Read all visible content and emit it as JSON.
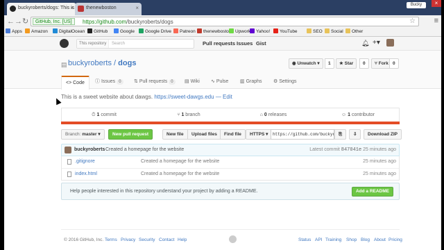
{
  "browser": {
    "tabs": [
      {
        "title": "buckyroberts/dogs: This is"
      },
      {
        "title": "thenewboston"
      }
    ],
    "profile_name": "Bucky",
    "address": {
      "secure_label": "GitHub, Inc. [US]",
      "url_host": "https://github.com",
      "url_path": "/buckyroberts/dogs"
    },
    "bookmarks": [
      {
        "label": "Apps",
        "color": "#4a7bd6"
      },
      {
        "label": "Amazon",
        "color": "#f39a1f"
      },
      {
        "label": "DigitalOcean",
        "color": "#1f8ad6"
      },
      {
        "label": "GitHub",
        "color": "#222222"
      },
      {
        "label": "Google",
        "color": "#4285f4"
      },
      {
        "label": "Google Drive",
        "color": "#1fa463"
      },
      {
        "label": "Patreon",
        "color": "#f96854"
      },
      {
        "label": "thenewboston",
        "color": "#c0392b"
      },
      {
        "label": "Upwork",
        "color": "#6fda44"
      },
      {
        "label": "Yahoo!",
        "color": "#6001d2"
      },
      {
        "label": "YouTube",
        "color": "#e62117"
      },
      {
        "label": "SEO",
        "color": "#e8c35a"
      },
      {
        "label": "Social",
        "color": "#e8c35a"
      },
      {
        "label": "Other",
        "color": "#e8c35a"
      }
    ]
  },
  "github": {
    "search_scope": "This repository",
    "search_placeholder": "Search",
    "nav": [
      "Pull requests",
      "Issues",
      "Gist"
    ]
  },
  "repo": {
    "owner": "buckyroberts",
    "separator": "/",
    "name": "dogs",
    "watch": {
      "label": "Unwatch ▾",
      "count": "1"
    },
    "star": {
      "label": "Star",
      "count": "0"
    },
    "fork": {
      "label": "Fork",
      "count": "0"
    },
    "tabs": [
      {
        "label": "Code",
        "count": ""
      },
      {
        "label": "Issues",
        "count": "0"
      },
      {
        "label": "Pull requests",
        "count": "0"
      },
      {
        "label": "Wiki",
        "count": ""
      },
      {
        "label": "Pulse",
        "count": ""
      },
      {
        "label": "Graphs",
        "count": ""
      },
      {
        "label": "Settings",
        "count": ""
      }
    ],
    "description": "This is a sweet website about dawgs.",
    "website": "https://sweet-dawgs.edu",
    "edit_label": "— Edit",
    "summary": {
      "commits": {
        "num": "1",
        "label": "commit"
      },
      "branches": {
        "num": "1",
        "label": "branch"
      },
      "releases": {
        "num": "0",
        "label": "releases"
      },
      "contributors": {
        "num": "1",
        "label": "contributor"
      }
    },
    "lang_color": "#e34c26",
    "branch_label": "Branch:",
    "branch_value": "master ▾",
    "new_pr": "New pull request",
    "file_buttons": [
      "New file",
      "Upload files",
      "Find file"
    ],
    "clone_protocol": "HTTPS ▾",
    "clone_url": "https://github.com/buckyroberts/dogs.git",
    "download": "Download ZIP",
    "latest_commit": {
      "author": "buckyroberts",
      "message": "Created a homepage for the website",
      "label": "Latest commit",
      "sha": "847041e",
      "age": "25 minutes ago"
    },
    "files": [
      {
        "name": ".gitignore",
        "message": "Created a homepage for the website",
        "age": "25 minutes ago"
      },
      {
        "name": "index.html",
        "message": "Created a homepage for the website",
        "age": "25 minutes ago"
      }
    ],
    "readme_prompt": "Help people interested in this repository understand your project by adding a README.",
    "readme_button": "Add a README"
  },
  "footer": {
    "copyright": "© 2016 GitHub, Inc.",
    "left_links": [
      "Terms",
      "Privacy",
      "Security",
      "Contact",
      "Help"
    ],
    "right_links": [
      "Status",
      "API",
      "Training",
      "Shop",
      "Blog",
      "About",
      "Pricing"
    ]
  }
}
